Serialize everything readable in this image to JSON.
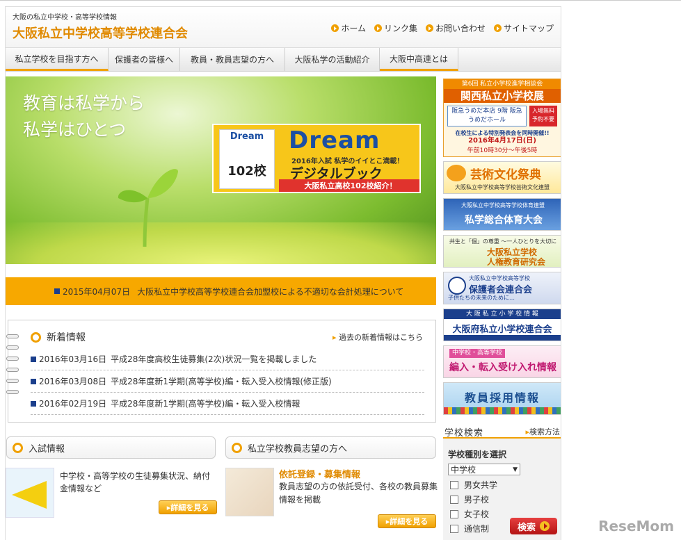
{
  "header": {
    "tagline": "大阪の私立中学校・高等学校情報",
    "title": "大阪私立中学校高等学校連合会",
    "links": [
      "ホーム",
      "リンク集",
      "お問い合わせ",
      "サイトマップ"
    ]
  },
  "gnav": [
    "私立学校を目指す方へ",
    "保護者の皆様へ",
    "教員・教員志望の方へ",
    "大阪私学の活動紹介",
    "大阪中高連とは"
  ],
  "hero": {
    "line1": "教育は私学から",
    "line2": "私学はひとつ",
    "dream": {
      "word": "Dream",
      "sub": "2016年入試 私学のイイとこ満載！",
      "digital": "デジタルブック",
      "bar": "大阪私立高校102校紹介！",
      "book_text": "102校"
    }
  },
  "notice": {
    "date": "2015年04月07日",
    "text": "大阪私立中学校高等学校連合会加盟校による不適切な会計処理について"
  },
  "news": {
    "title": "新着情報",
    "past_link": "過去の新着情報はこちら",
    "items": [
      {
        "date": "2016年03月16日",
        "text": "平成28年度高校生徒募集(2次)状況一覧を掲載しました"
      },
      {
        "date": "2016年03月08日",
        "text": "平成28年度新1学期(高等学校)編・転入受入校情報(修正版)"
      },
      {
        "date": "2016年02月19日",
        "text": "平成28年度新1学期(高等学校)編・転入受入校情報"
      }
    ]
  },
  "nyushi": {
    "title": "入試情報",
    "text": "中学校・高等学校の生徒募集状況、納付金情報など",
    "button": "詳細を見る"
  },
  "kyoin": {
    "title": "私立学校教員志望の方へ",
    "subtitle": "依託登録・募集情報",
    "text": "教員志望の方の依託受付、各校の教員募集情報を掲載",
    "button": "詳細を見る"
  },
  "banners": {
    "expo": {
      "top": "第6回 私立小学校進学相談会",
      "big": "関西私立小学校展",
      "place": "阪急うめだ本店 9階 阪急うめだホール",
      "free": "入場無料 予約不要",
      "note": "在校生による特別発表会を同時開催!!",
      "date": "2016年4月17日(日)",
      "time": "午前10時30分～午後5時"
    },
    "art": {
      "title": "芸術文化祭典",
      "sub": "大阪私立中学校高等学校芸術文化連盟"
    },
    "sports": {
      "top": "大阪私立中学校高等学校体育連盟",
      "title": "私学総合体育大会"
    },
    "human": {
      "top": "共生と「個」の尊重 ～一人ひとりを大切に～",
      "t1": "大阪私立学校",
      "t2": "人権教育研究会"
    },
    "parents": {
      "top": "大阪私立中学校高等学校",
      "title": "保護者会連合会",
      "sub": "子供たちの未来のために…"
    },
    "elem": {
      "top": "大 阪 私 立 小 学 校 情 報",
      "title": "大阪府私立小学校連合会"
    },
    "transfer": {
      "top": "中学校・高等学校",
      "title": "編入・転入受け入れ情報"
    },
    "recruit": {
      "title": "教員採用情報"
    }
  },
  "search": {
    "title": "学校検索",
    "how": "検索方法",
    "label": "学校種別を選択",
    "select_value": "中学校",
    "options": [
      "男女共学",
      "男子校",
      "女子校",
      "通信制"
    ],
    "button": "検索"
  },
  "watermark": "ReseMom"
}
